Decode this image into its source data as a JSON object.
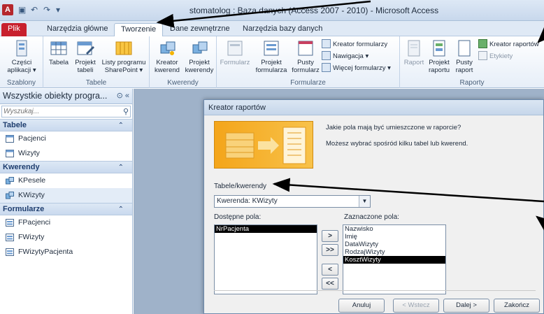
{
  "window": {
    "title": "stomatolog : Baza danych (Access 2007 - 2010)  -  Microsoft Access",
    "app_icon": "A"
  },
  "tabs": [
    {
      "label": "Plik"
    },
    {
      "label": "Narzędzia główne"
    },
    {
      "label": "Tworzenie"
    },
    {
      "label": "Dane zewnętrzne"
    },
    {
      "label": "Narzędzia bazy danych"
    }
  ],
  "ribbon": {
    "groups": {
      "szablony": "Szablony",
      "tabele": "Tabele",
      "kwerendy": "Kwerendy",
      "formularze": "Formularze",
      "raporty": "Raporty"
    },
    "buttons": {
      "czesci": "Części aplikacji",
      "tabela": "Tabela",
      "projekt_tabeli": "Projekt tabeli",
      "listy_sharepoint": "Listy programu SharePoint",
      "kreator_kwerend": "Kreator kwerend",
      "projekt_kwerendy": "Projekt kwerendy",
      "formularz": "Formularz",
      "projekt_formularza": "Projekt formularza",
      "pusty_formularz": "Pusty formularz",
      "kreator_formularzy": "Kreator formularzy",
      "nawigacja": "Nawigacja",
      "wiecej_formularzy": "Więcej formularzy",
      "raport": "Raport",
      "projekt_raportu": "Projekt raportu",
      "pusty_raport": "Pusty raport",
      "kreator_raportow": "Kreator raportów",
      "etykiety": "Etykiety"
    }
  },
  "nav": {
    "header": "Wszystkie obiekty progra...",
    "search_placeholder": "Wyszukaj...",
    "categories": [
      {
        "label": "Tabele",
        "items": [
          "Pacjenci",
          "Wizyty"
        ]
      },
      {
        "label": "Kwerendy",
        "items": [
          "KPesele",
          "KWizyty"
        ]
      },
      {
        "label": "Formularze",
        "items": [
          "FPacjenci",
          "FWizyty",
          "FWizytyPacjenta"
        ]
      }
    ]
  },
  "dialog": {
    "title": "Kreator raportów",
    "question": "Jakie pola mają być umieszczone w raporcie?",
    "hint": "Możesz wybrać spośród kilku tabel lub kwerend.",
    "tables_label": "Tabele/kwerendy",
    "combo_value": "Kwerenda: KWizyty",
    "available_label": "Dostępne pola:",
    "selected_label": "Zaznaczone pola:",
    "available_fields": [
      "NrPacjenta"
    ],
    "selected_fields": [
      "Nazwisko",
      "Imię",
      "DataWizyty",
      "RodzajWizyty",
      "KosztWizyty"
    ],
    "move_buttons": [
      ">",
      ">>",
      "<",
      "<<"
    ],
    "buttons": {
      "cancel": "Anuluj",
      "back": "< Wstecz",
      "next": "Dalej >",
      "finish": "Zakończ"
    }
  },
  "colors": {
    "file_tab": "#c8202d",
    "workspace": "#9fb2c9",
    "dialog_graphic": "#f4a51a"
  }
}
